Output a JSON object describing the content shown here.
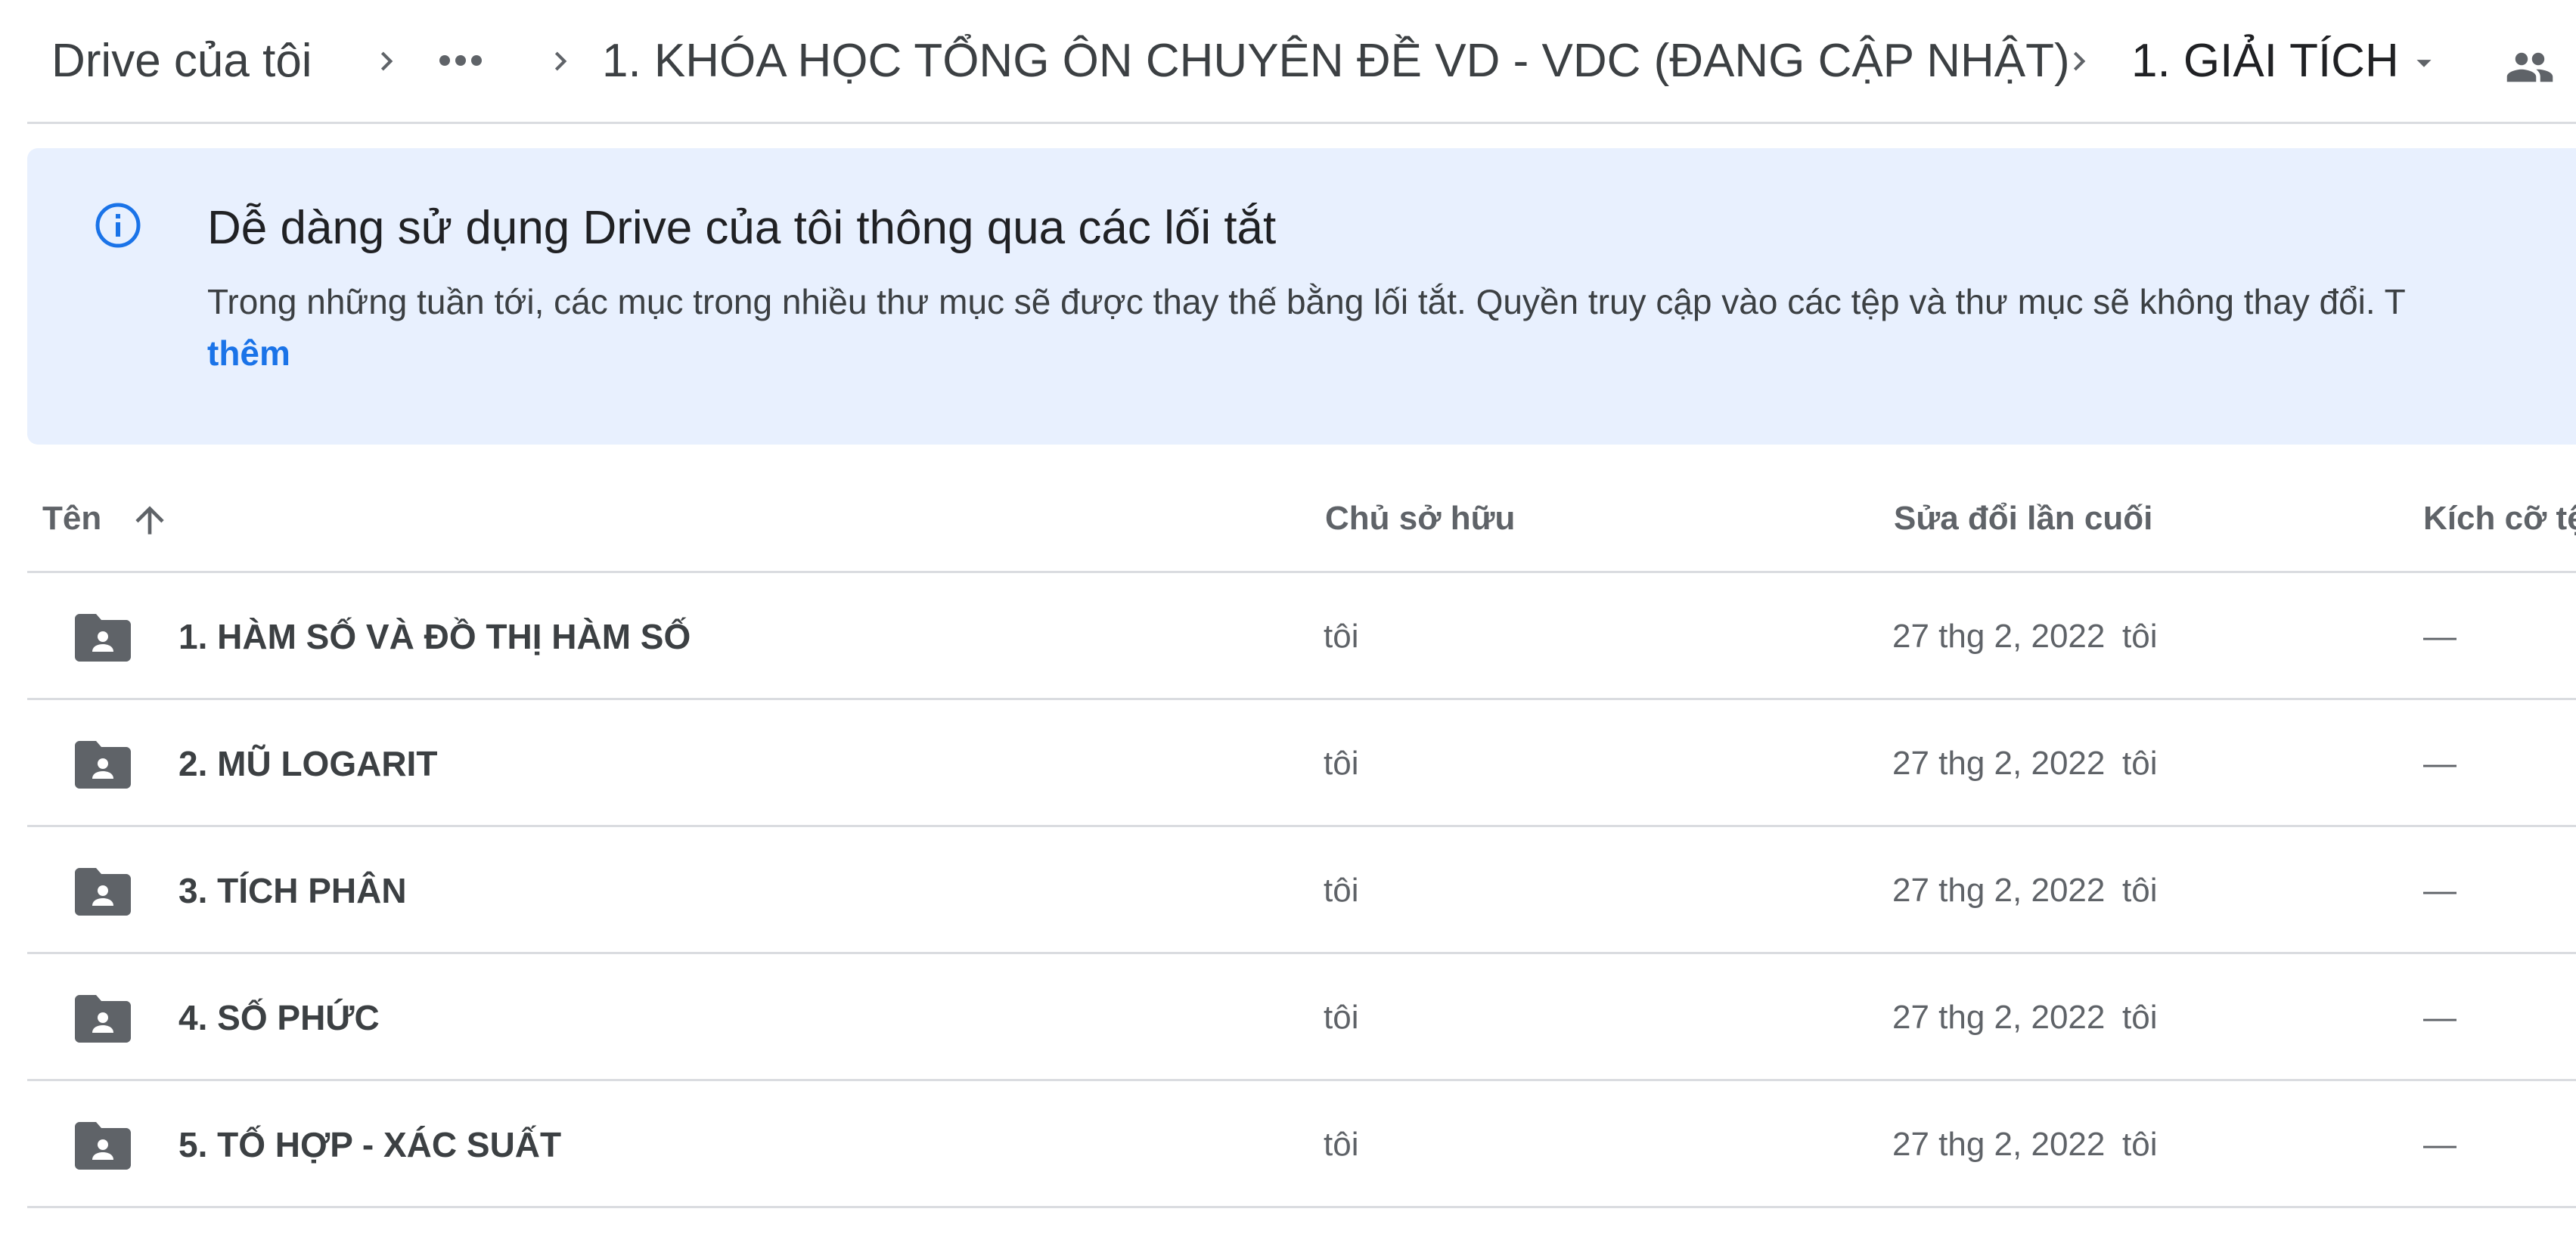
{
  "breadcrumb": {
    "root": "Drive của tôi",
    "more_icon": "more-horiz-icon",
    "course": "1. KHÓA HỌC TỔNG ÔN CHUYÊN ĐỀ VD - VDC (ĐANG CẬP NHẬT)",
    "current": "1. GIẢI TÍCH",
    "separator_icon": "chevron-right-icon",
    "dropdown_icon": "arrow-drop-down-icon",
    "shared_icon": "people-icon"
  },
  "banner": {
    "icon": "info-icon",
    "title": "Dễ dàng sử dụng Drive của tôi thông qua các lối tắt",
    "body": "Trong những tuần tới, các mục trong nhiều thư mục sẽ được thay thế bằng lối tắt. Quyền truy cập vào các tệp và thư mục sẽ không thay đổi. T",
    "link": "thêm",
    "background": "#e8f0fe",
    "link_color": "#1a73e8"
  },
  "columns": {
    "name": "Tên",
    "sort_icon": "arrow-upward-icon",
    "owner": "Chủ sở hữu",
    "modified": "Sửa đổi lần cuối",
    "size": "Kích cỡ tệ"
  },
  "rows": [
    {
      "name": "1. HÀM SỐ VÀ ĐỒ THỊ HÀM SỐ",
      "owner": "tôi",
      "modified": "27 thg 2, 2022",
      "modified_by": "tôi",
      "size": "—",
      "icon": "shared-folder-icon"
    },
    {
      "name": "2. MŨ LOGARIT",
      "owner": "tôi",
      "modified": "27 thg 2, 2022",
      "modified_by": "tôi",
      "size": "—",
      "icon": "shared-folder-icon"
    },
    {
      "name": "3. TÍCH PHÂN",
      "owner": "tôi",
      "modified": "27 thg 2, 2022",
      "modified_by": "tôi",
      "size": "—",
      "icon": "shared-folder-icon"
    },
    {
      "name": "4. SỐ PHỨC",
      "owner": "tôi",
      "modified": "27 thg 2, 2022",
      "modified_by": "tôi",
      "size": "—",
      "icon": "shared-folder-icon"
    },
    {
      "name": "5. TỐ HỢP - XÁC SUẤT",
      "owner": "tôi",
      "modified": "27 thg 2, 2022",
      "modified_by": "tôi",
      "size": "—",
      "icon": "shared-folder-icon"
    }
  ]
}
